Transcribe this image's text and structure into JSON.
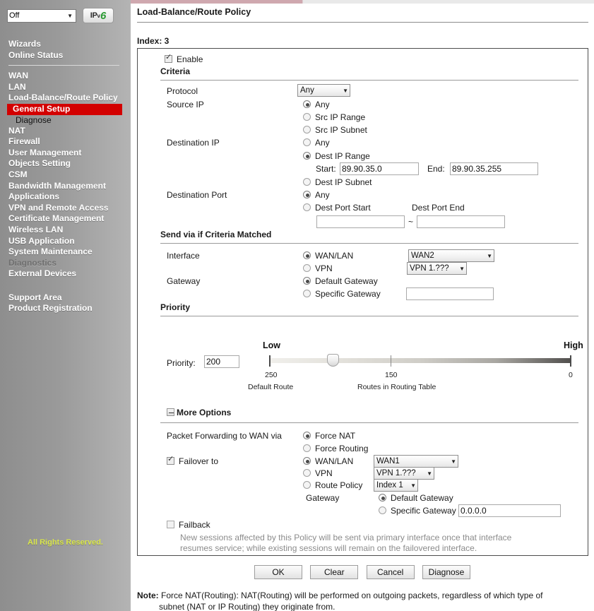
{
  "sidebar": {
    "ipv6_select": {
      "value": "Off",
      "arrow": "chevron-down-icon"
    },
    "ipv6_logo": {
      "ip": "IP",
      "v": "v",
      "six": "6"
    },
    "top_items": [
      {
        "label": "Wizards"
      },
      {
        "label": "Online Status"
      }
    ],
    "items": [
      {
        "label": "WAN",
        "state": "normal"
      },
      {
        "label": "LAN",
        "state": "normal"
      },
      {
        "label": "Load-Balance/Route Policy",
        "state": "normal"
      },
      {
        "label": "General Setup",
        "state": "active"
      },
      {
        "label": "Diagnose",
        "state": "sub"
      },
      {
        "label": "NAT",
        "state": "normal"
      },
      {
        "label": "Firewall",
        "state": "normal"
      },
      {
        "label": "User Management",
        "state": "normal"
      },
      {
        "label": "Objects Setting",
        "state": "normal"
      },
      {
        "label": "CSM",
        "state": "normal"
      },
      {
        "label": "Bandwidth Management",
        "state": "normal"
      },
      {
        "label": "Applications",
        "state": "normal"
      },
      {
        "label": "VPN and Remote Access",
        "state": "normal"
      },
      {
        "label": "Certificate Management",
        "state": "normal"
      },
      {
        "label": "Wireless LAN",
        "state": "normal"
      },
      {
        "label": "USB Application",
        "state": "normal"
      },
      {
        "label": "System Maintenance",
        "state": "normal"
      },
      {
        "label": "Diagnostics",
        "state": "dim"
      },
      {
        "label": "External Devices",
        "state": "normal"
      }
    ],
    "support_items": [
      {
        "label": "Support Area"
      },
      {
        "label": "Product Registration"
      }
    ],
    "rights": "All Rights Reserved.",
    "accent_active": "#d30000",
    "rights_color": "#d9e64a"
  },
  "header": {
    "title": "Load-Balance/Route Policy",
    "index_label": "Index: 3"
  },
  "form": {
    "enable": {
      "label": "Enable",
      "checked": true
    },
    "criteria_heading": "Criteria",
    "protocol": {
      "label": "Protocol",
      "value": "Any"
    },
    "source_ip": {
      "label": "Source IP",
      "options": [
        {
          "label": "Any",
          "selected": true
        },
        {
          "label": "Src IP Range",
          "selected": false
        },
        {
          "label": "Src IP Subnet",
          "selected": false
        }
      ]
    },
    "destination_ip": {
      "label": "Destination IP",
      "options": [
        {
          "label": "Any",
          "selected": false
        },
        {
          "label": "Dest IP Range",
          "selected": true
        },
        {
          "label": "Dest IP Subnet",
          "selected": false
        }
      ],
      "start_label": "Start:",
      "start_value": "89.90.35.0",
      "end_label": "End:",
      "end_value": "89.90.35.255"
    },
    "destination_port": {
      "label": "Destination Port",
      "options": [
        {
          "label": "Any",
          "selected": true
        },
        {
          "label": "Dest Port Start",
          "selected": false
        }
      ],
      "end_label": "Dest Port End",
      "start_value": "",
      "end_value": "",
      "separator": "~"
    },
    "send_via_heading": "Send via if Criteria Matched",
    "interface": {
      "label": "Interface",
      "options": [
        {
          "label": "WAN/LAN",
          "selected": true
        },
        {
          "label": "VPN",
          "selected": false
        }
      ],
      "wan_value": "WAN2",
      "vpn_value": "VPN 1.???"
    },
    "gateway": {
      "label": "Gateway",
      "options": [
        {
          "label": "Default Gateway",
          "selected": true
        },
        {
          "label": "Specific Gateway",
          "selected": false
        }
      ],
      "specific_value": ""
    },
    "priority_heading": "Priority",
    "priority": {
      "label": "Priority:",
      "value": "200",
      "low_label": "Low",
      "high_label": "High",
      "ticks": [
        {
          "num": "250",
          "sub": "Default Route"
        },
        {
          "num": "150",
          "sub": "Routes in Routing Table"
        },
        {
          "num": "0",
          "sub": ""
        }
      ]
    },
    "more_options": {
      "label": "More Options",
      "expanded": true
    },
    "packet_forwarding": {
      "label": "Packet Forwarding to WAN via",
      "options": [
        {
          "label": "Force NAT",
          "selected": true
        },
        {
          "label": "Force Routing",
          "selected": false
        }
      ]
    },
    "failover": {
      "label": "Failover to",
      "checked": true,
      "options": [
        {
          "label": "WAN/LAN",
          "selected": true
        },
        {
          "label": "VPN",
          "selected": false
        },
        {
          "label": "Route Policy",
          "selected": false
        }
      ],
      "wan_value": "WAN1",
      "vpn_value": "VPN 1.???",
      "route_policy_value": "Index 1",
      "gateway_label": "Gateway",
      "gateway_options": [
        {
          "label": "Default Gateway",
          "selected": true
        },
        {
          "label": "Specific Gateway",
          "selected": false
        }
      ],
      "gateway_specific_value": "0.0.0.0"
    },
    "failback": {
      "label": "Failback",
      "checked": false,
      "description_line1": "New sessions affected by this Policy will be sent via primary interface once that interface",
      "description_line2": "resumes service; while existing sessions will remain on the failovered interface."
    }
  },
  "buttons": [
    {
      "label": "OK"
    },
    {
      "label": "Clear"
    },
    {
      "label": "Cancel"
    },
    {
      "label": "Diagnose"
    }
  ],
  "footer": {
    "note_label": "Note:",
    "note_line1": "Force NAT(Routing): NAT(Routing) will be performed on outgoing packets, regardless of which type of",
    "note_line2": "subnet (NAT or IP Routing) they originate from."
  }
}
